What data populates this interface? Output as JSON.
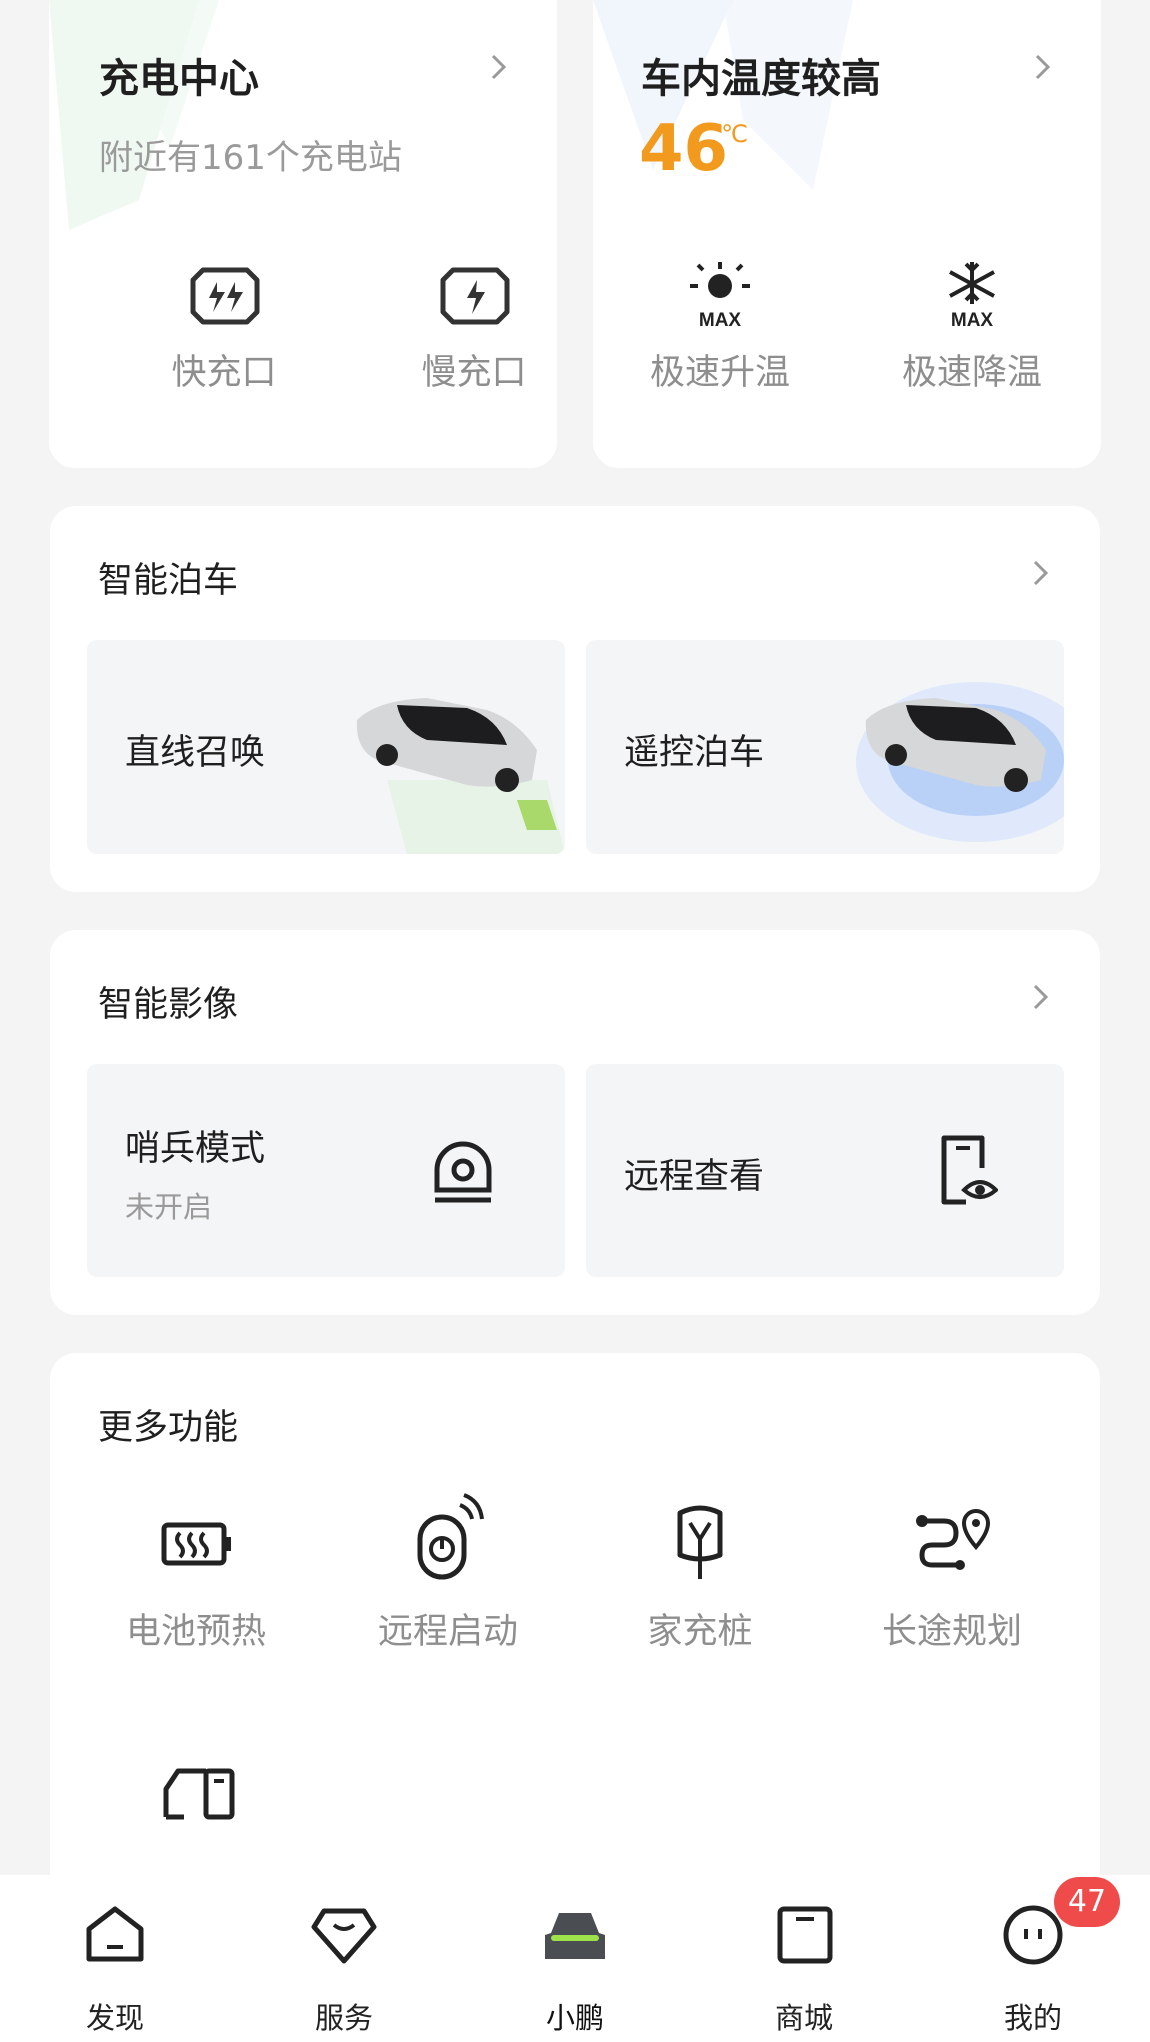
{
  "charging": {
    "title": "充电中心",
    "subtitle": "附近有161个充电站",
    "fast_label": "快充口",
    "slow_label": "慢充口"
  },
  "climate": {
    "title": "车内温度较高",
    "temperature": "46",
    "unit": "℃",
    "heat_label": "极速升温",
    "cool_label": "极速降温",
    "max_text": "MAX"
  },
  "parking": {
    "title": "智能泊车",
    "summon_label": "直线召唤",
    "remote_label": "遥控泊车"
  },
  "imaging": {
    "title": "智能影像",
    "sentry_label": "哨兵模式",
    "sentry_status": "未开启",
    "remote_view_label": "远程查看"
  },
  "more": {
    "title": "更多功能",
    "items": [
      "电池预热",
      "远程启动",
      "家充桩",
      "长途规划"
    ]
  },
  "nav": {
    "items": [
      "发现",
      "服务",
      "小鹏",
      "商城",
      "我的"
    ],
    "badge": "47"
  },
  "colors": {
    "temperature": "#f29a1d",
    "accent_green": "#9ee24b",
    "badge": "#f04b4b"
  }
}
